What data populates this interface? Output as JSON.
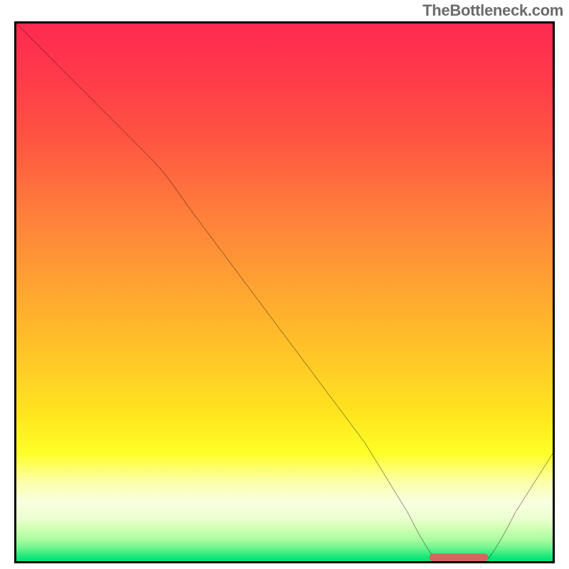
{
  "watermark": "TheBottleneck.com",
  "colors": {
    "border": "#000000",
    "line": "#000000",
    "marker_fill": "#d9635f",
    "gradient_top": "#ff2a51",
    "gradient_mid": "#ffe61e",
    "gradient_bottom": "#0cdd78"
  },
  "chart_data": {
    "type": "line",
    "title": "",
    "xlabel": "",
    "ylabel": "",
    "xlim": [
      0,
      100
    ],
    "ylim": [
      0,
      100
    ],
    "grid": false,
    "legend": false,
    "series": [
      {
        "name": "curve",
        "x": [
          0,
          10,
          25,
          35,
          50,
          65,
          75,
          80,
          85,
          90,
          100
        ],
        "y": [
          100,
          90,
          75,
          62,
          42,
          22,
          5,
          0,
          0,
          5,
          20
        ]
      },
      {
        "name": "optimum-marker",
        "x": [
          78,
          88
        ],
        "y": [
          0.3,
          0.3
        ]
      }
    ],
    "note": "y is a qualitative 'bottleneck badness' scale: 0 = optimal (green), 100 = worst (red). Values estimated from curve position against gradient; axes have no visible ticks."
  }
}
